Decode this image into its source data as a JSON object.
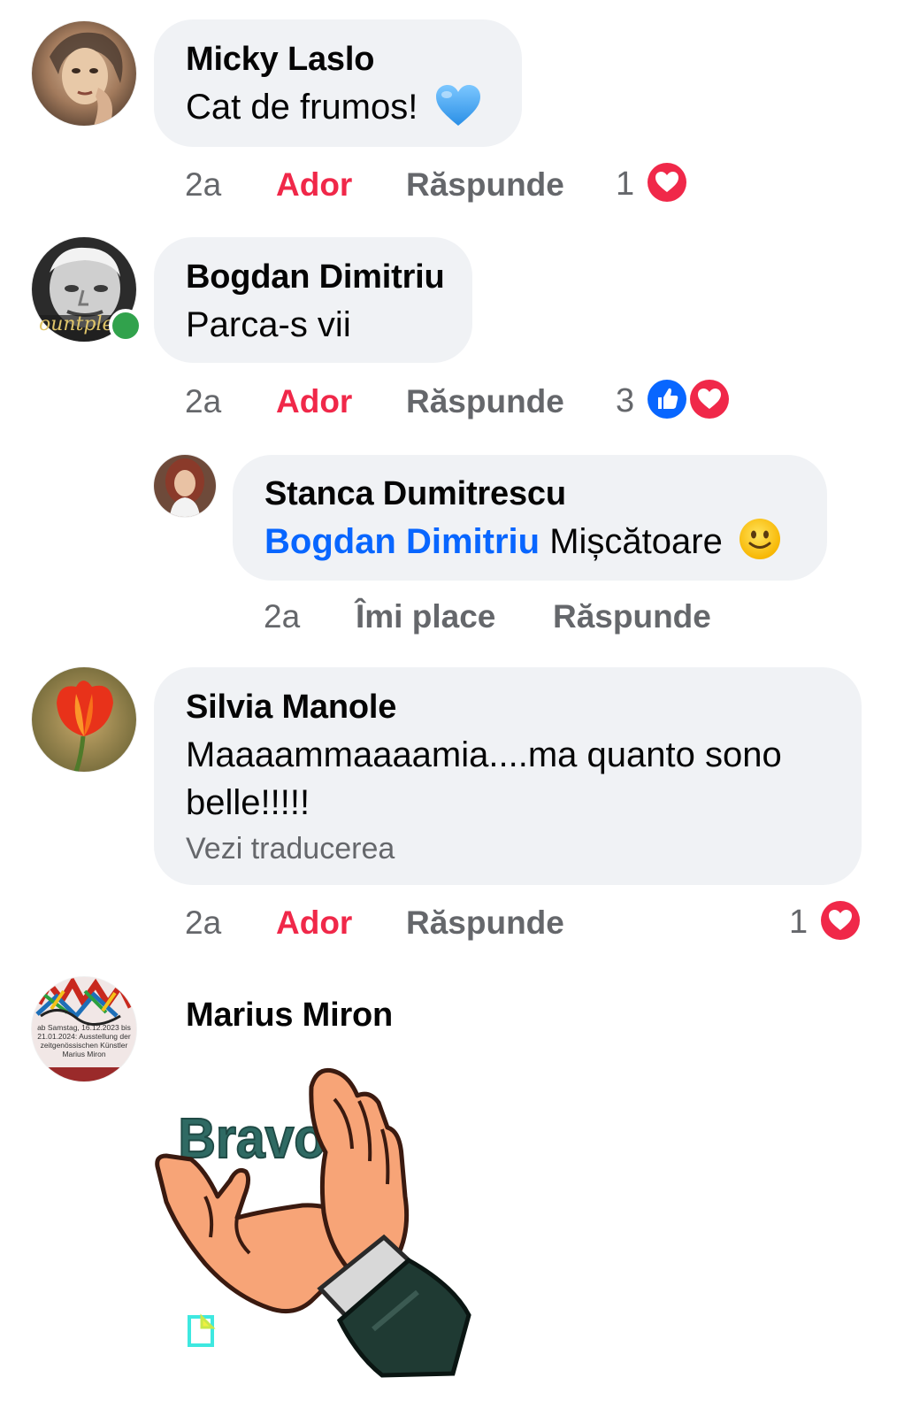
{
  "colors": {
    "bubble": "#f0f2f5",
    "love": "#f02849",
    "like": "#0866ff",
    "meta": "#65676b",
    "online": "#31a24c"
  },
  "comments": [
    {
      "author": "Micky Laslo",
      "text": "Cat de frumos!",
      "emoji": "blue-heart",
      "time": "2a",
      "reaction_action": "Ador",
      "reply_action": "Răspunde",
      "reaction_count": "1",
      "reactions": [
        "love"
      ]
    },
    {
      "author": "Bogdan Dimitriu",
      "text": "Parca-s vii",
      "online": true,
      "time": "2a",
      "reaction_action": "Ador",
      "reply_action": "Răspunde",
      "reaction_count": "3",
      "reactions": [
        "like",
        "love"
      ],
      "replies": [
        {
          "author": "Stanca Dumitrescu",
          "mention": "Bogdan Dimitriu",
          "text": "Mișcătoare",
          "emoji": "slightly-smiling-face",
          "time": "2a",
          "reaction_action": "Îmi place",
          "reply_action": "Răspunde"
        }
      ]
    },
    {
      "author": "Silvia Manole",
      "text_line1": "Maaaammaaaamia....ma quanto sono",
      "text_line2": "belle!!!!!",
      "translate_link": "Vezi traducerea",
      "time": "2a",
      "reaction_action": "Ador",
      "reply_action": "Răspunde",
      "reaction_count": "1",
      "reactions": [
        "love"
      ]
    },
    {
      "author": "Marius Miron",
      "avatar_text": [
        "ab Samstag, 16.12.2023 bis",
        "21.01.2024: Ausstellung der",
        "zeitgenössischen Künstler",
        "Marius Miron"
      ],
      "sticker": {
        "name": "bravo-clapping-hands-gif",
        "caption": "Bravo"
      }
    }
  ]
}
